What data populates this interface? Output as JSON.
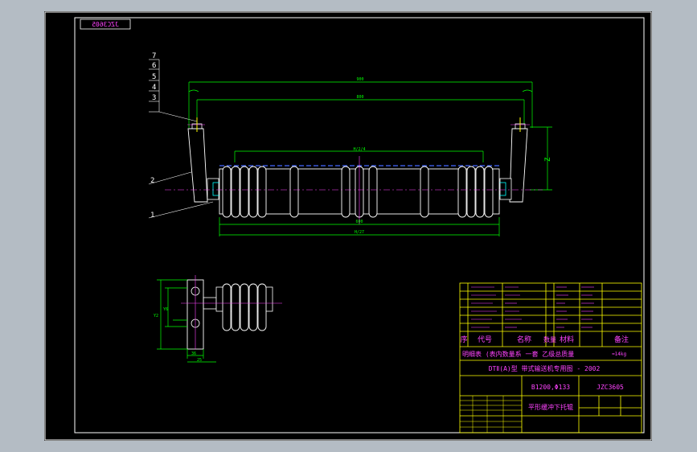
{
  "drawing": {
    "code_box_mirrored": "JZC3605",
    "callouts": [
      "7",
      "6",
      "5",
      "4",
      "3",
      "2",
      "1"
    ],
    "dims_top": [
      "900",
      "800"
    ],
    "dims_mid": [
      "H/2/4"
    ],
    "dims_bottom": [
      "600",
      "H/27"
    ],
    "dim_height": "Z",
    "detail_dims": [
      "Y2",
      "Y6",
      "36",
      "25"
    ]
  },
  "title_block": {
    "header": {
      "seq": "序",
      "code": "代号",
      "name": "名称",
      "qty": "数量",
      "material": "材料",
      "note": "备注"
    },
    "summary_line": "明细表  (表内数量系  一套  乙级总质量",
    "summary_suffix": "≈14kg",
    "subtitle": "DTⅡ(A)型  带式输送机专用图 - 2002",
    "spec": "B1200,Φ133",
    "drawing_code": "JZC3605",
    "drawing_name": "平形缓冲下托辊"
  }
}
